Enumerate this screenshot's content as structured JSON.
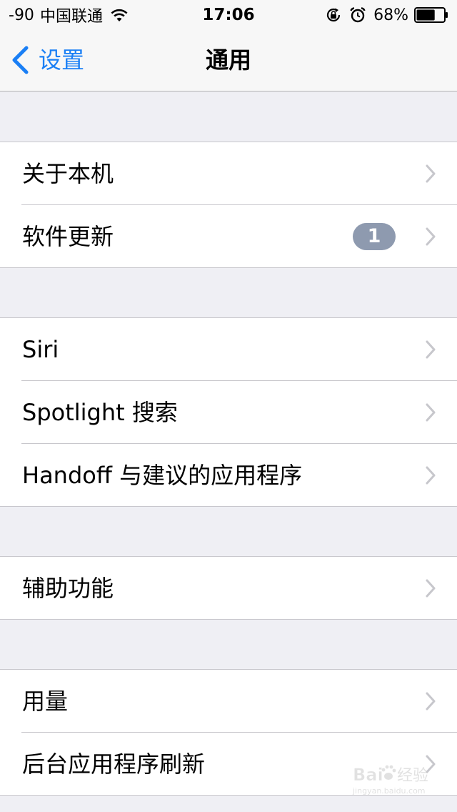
{
  "status_bar": {
    "signal": "-90",
    "carrier": "中国联通",
    "time": "17:06",
    "battery_percent": "68%",
    "battery_level": 0.68,
    "icons": [
      "wifi-icon",
      "rotation-lock-icon",
      "alarm-icon",
      "battery-icon"
    ]
  },
  "nav": {
    "back_label": "设置",
    "title": "通用",
    "accent_color": "#1a7ff5"
  },
  "groups": [
    {
      "items": [
        {
          "label": "关于本机"
        },
        {
          "label": "软件更新",
          "badge": "1"
        }
      ]
    },
    {
      "items": [
        {
          "label": "Siri"
        },
        {
          "label": "Spotlight 搜索"
        },
        {
          "label": "Handoff 与建议的应用程序"
        }
      ]
    },
    {
      "items": [
        {
          "label": "辅助功能"
        }
      ]
    },
    {
      "items": [
        {
          "label": "用量"
        },
        {
          "label": "后台应用程序刷新"
        }
      ]
    }
  ],
  "watermark": {
    "text": "Baidu 经验",
    "subtext": "jingyan.baidu.com"
  }
}
